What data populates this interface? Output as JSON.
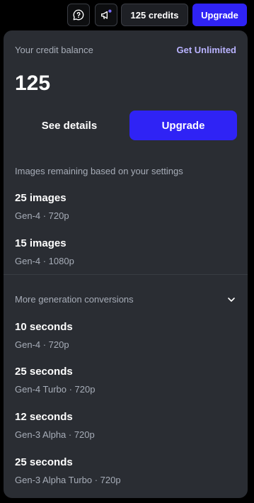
{
  "topbar": {
    "feedback_icon": "chat-question-icon",
    "announcements_icon": "megaphone-icon",
    "credits_label": "125 credits",
    "upgrade_label": "Upgrade"
  },
  "panel": {
    "balance_label": "Your credit balance",
    "get_unlimited": "Get Unlimited",
    "balance_value": "125",
    "see_details_label": "See details",
    "upgrade_label": "Upgrade",
    "images_heading": "Images remaining based on your settings",
    "images": [
      {
        "title": "25 images",
        "sub": "Gen-4 · 720p"
      },
      {
        "title": "15 images",
        "sub": "Gen-4 · 1080p"
      }
    ],
    "conversions_heading": "More generation conversions",
    "conversions": [
      {
        "title": "10 seconds",
        "sub": "Gen-4 · 720p"
      },
      {
        "title": "25 seconds",
        "sub": "Gen-4 Turbo · 720p"
      },
      {
        "title": "12 seconds",
        "sub": "Gen-3 Alpha · 720p"
      },
      {
        "title": "25 seconds",
        "sub": "Gen-3 Alpha Turbo · 720p"
      }
    ]
  },
  "colors": {
    "accent": "#2f23f5",
    "link": "#b9b3ff",
    "panel_bg": "#2a2d33",
    "notification_dot": "#7a6cff"
  }
}
